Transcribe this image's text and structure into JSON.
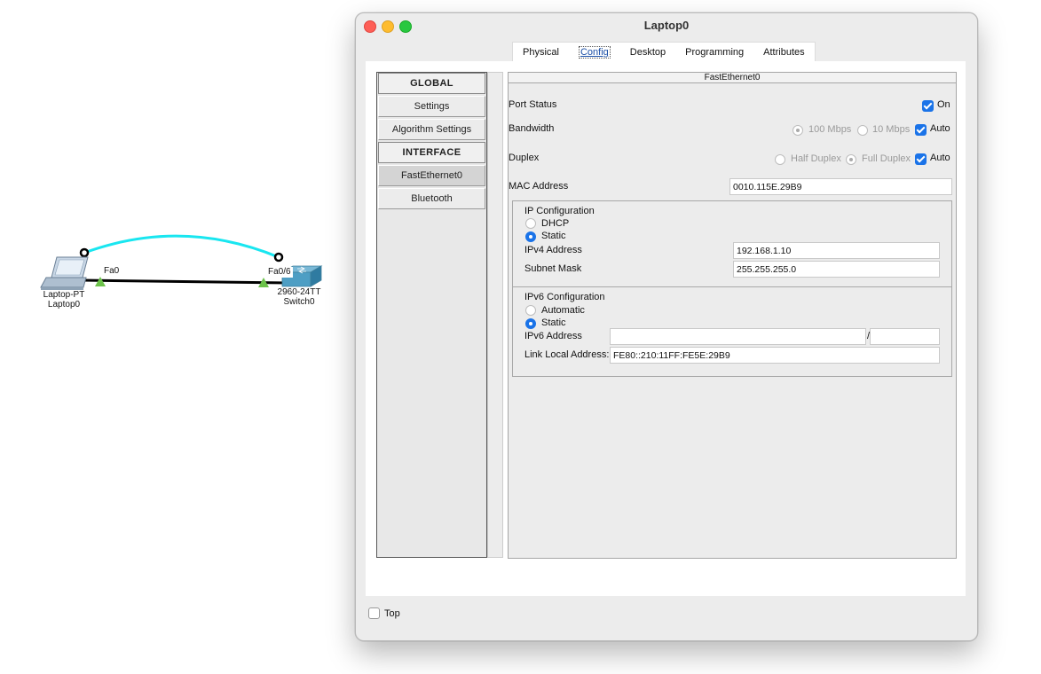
{
  "topology": {
    "laptop": {
      "type_label": "Laptop-PT",
      "name_label": "Laptop0",
      "port_label": "Fa0"
    },
    "switch": {
      "type_label": "2960-24TT",
      "name_label": "Switch0",
      "port_label": "Fa0/6"
    },
    "colors": {
      "link": "#000000",
      "link_arc": "#19e6f0",
      "port_up": "#6cc24a"
    }
  },
  "window": {
    "title": "Laptop0",
    "tabs": [
      {
        "label": "Physical",
        "active": false
      },
      {
        "label": "Config",
        "active": true
      },
      {
        "label": "Desktop",
        "active": false
      },
      {
        "label": "Programming",
        "active": false
      },
      {
        "label": "Attributes",
        "active": false
      }
    ],
    "sidebar": {
      "items": [
        {
          "label": "GLOBAL",
          "kind": "header"
        },
        {
          "label": "Settings",
          "kind": "item"
        },
        {
          "label": "Algorithm Settings",
          "kind": "item"
        },
        {
          "label": "INTERFACE",
          "kind": "header"
        },
        {
          "label": "FastEthernet0",
          "kind": "item",
          "selected": true
        },
        {
          "label": "Bluetooth",
          "kind": "item"
        }
      ]
    },
    "interface": {
      "title": "FastEthernet0",
      "port_status": {
        "label": "Port Status",
        "on_label": "On",
        "checked": true
      },
      "bandwidth": {
        "label": "Bandwidth",
        "opt1": "100 Mbps",
        "opt2": "10 Mbps",
        "auto_label": "Auto",
        "auto_checked": true
      },
      "duplex": {
        "label": "Duplex",
        "opt1": "Half Duplex",
        "opt2": "Full Duplex",
        "auto_label": "Auto",
        "auto_checked": true
      },
      "mac": {
        "label": "MAC Address",
        "value": "0010.115E.29B9"
      },
      "ip_config": {
        "title": "IP Configuration",
        "dhcp_label": "DHCP",
        "static_label": "Static",
        "selected": "Static",
        "ipv4_label": "IPv4 Address",
        "ipv4_value": "192.168.1.10",
        "mask_label": "Subnet Mask",
        "mask_value": "255.255.255.0"
      },
      "ipv6_config": {
        "title": "IPv6 Configuration",
        "auto_label": "Automatic",
        "static_label": "Static",
        "selected": "Static",
        "ipv6_label": "IPv6 Address",
        "ipv6_value": "",
        "prefix_sep": "/",
        "prefix_value": "",
        "link_local_label": "Link Local Address:",
        "link_local_value": "FE80::210:11FF:FE5E:29B9"
      }
    },
    "top_checkbox": {
      "label": "Top",
      "checked": false
    }
  }
}
